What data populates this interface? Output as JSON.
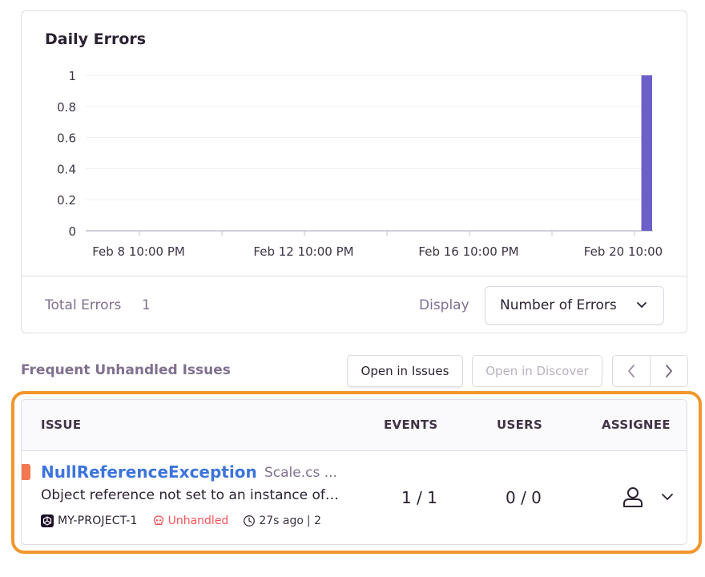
{
  "chart_card": {
    "title": "Daily Errors",
    "total_label": "Total Errors",
    "total_value": "1",
    "display_label": "Display",
    "display_value": "Number of Errors"
  },
  "chart_data": {
    "type": "bar",
    "title": "Daily Errors",
    "y_ticks": [
      "0",
      "0.2",
      "0.4",
      "0.6",
      "0.8",
      "1"
    ],
    "x_ticks": [
      "Feb 8 10:00 PM",
      "Feb 12 10:00 PM",
      "Feb 16 10:00 PM",
      "Feb 20 10:00"
    ],
    "ylim": [
      0,
      1
    ],
    "grid": true,
    "series": [
      {
        "values": [
          0,
          0,
          0,
          0,
          0,
          0,
          0,
          0,
          0,
          0,
          0,
          0,
          0,
          0,
          0,
          0,
          0,
          0,
          0,
          0,
          0,
          0,
          0,
          0,
          0,
          0,
          0,
          0,
          0,
          0,
          0,
          0,
          0,
          0,
          0,
          0,
          0,
          0,
          0,
          0,
          0,
          0,
          0,
          0,
          0,
          0,
          0,
          0,
          1
        ]
      }
    ],
    "color": "#6c5fc7"
  },
  "issues_section": {
    "title": "Frequent Unhandled Issues",
    "open_issues_label": "Open in Issues",
    "open_discover_label": "Open in Discover"
  },
  "table": {
    "headers": {
      "issue": "ISSUE",
      "events": "EVENTS",
      "users": "USERS",
      "assignee": "ASSIGNEE"
    },
    "rows": [
      {
        "title": "NullReferenceException",
        "file": "Scale.cs ...",
        "message": "Object reference not set to an instance of an object",
        "project": "MY-PROJECT-1",
        "handled": "Unhandled",
        "time": "27s ago",
        "separator": "| 2",
        "events": "1 / 1",
        "users": "0 / 0",
        "level_color": "#f4774e"
      }
    ]
  },
  "colors": {
    "accent": "#6c5fc7",
    "link": "#3d74db",
    "unhandled": "#f55459",
    "highlight": "#f2962d"
  },
  "icons": [
    "chevron-down-icon",
    "chevron-left-icon",
    "chevron-right-icon",
    "platform-icon",
    "skull-icon",
    "clock-icon",
    "user-icon"
  ]
}
